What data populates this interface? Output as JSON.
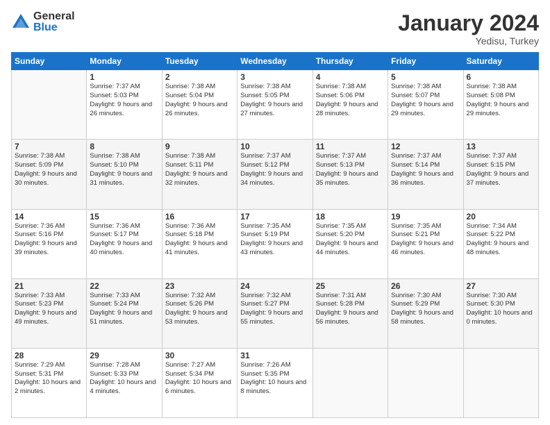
{
  "logo": {
    "general": "General",
    "blue": "Blue"
  },
  "title": "January 2024",
  "location": "Yedisu, Turkey",
  "days": [
    "Sunday",
    "Monday",
    "Tuesday",
    "Wednesday",
    "Thursday",
    "Friday",
    "Saturday"
  ],
  "weeks": [
    [
      {
        "day": null
      },
      {
        "day": 1,
        "sunrise": "7:37 AM",
        "sunset": "5:03 PM",
        "daylight": "9 hours and 26 minutes."
      },
      {
        "day": 2,
        "sunrise": "7:38 AM",
        "sunset": "5:04 PM",
        "daylight": "9 hours and 26 minutes."
      },
      {
        "day": 3,
        "sunrise": "7:38 AM",
        "sunset": "5:05 PM",
        "daylight": "9 hours and 27 minutes."
      },
      {
        "day": 4,
        "sunrise": "7:38 AM",
        "sunset": "5:06 PM",
        "daylight": "9 hours and 28 minutes."
      },
      {
        "day": 5,
        "sunrise": "7:38 AM",
        "sunset": "5:07 PM",
        "daylight": "9 hours and 29 minutes."
      },
      {
        "day": 6,
        "sunrise": "7:38 AM",
        "sunset": "5:08 PM",
        "daylight": "9 hours and 29 minutes."
      }
    ],
    [
      {
        "day": 7,
        "sunrise": "7:38 AM",
        "sunset": "5:09 PM",
        "daylight": "9 hours and 30 minutes."
      },
      {
        "day": 8,
        "sunrise": "7:38 AM",
        "sunset": "5:10 PM",
        "daylight": "9 hours and 31 minutes."
      },
      {
        "day": 9,
        "sunrise": "7:38 AM",
        "sunset": "5:11 PM",
        "daylight": "9 hours and 32 minutes."
      },
      {
        "day": 10,
        "sunrise": "7:37 AM",
        "sunset": "5:12 PM",
        "daylight": "9 hours and 34 minutes."
      },
      {
        "day": 11,
        "sunrise": "7:37 AM",
        "sunset": "5:13 PM",
        "daylight": "9 hours and 35 minutes."
      },
      {
        "day": 12,
        "sunrise": "7:37 AM",
        "sunset": "5:14 PM",
        "daylight": "9 hours and 36 minutes."
      },
      {
        "day": 13,
        "sunrise": "7:37 AM",
        "sunset": "5:15 PM",
        "daylight": "9 hours and 37 minutes."
      }
    ],
    [
      {
        "day": 14,
        "sunrise": "7:36 AM",
        "sunset": "5:16 PM",
        "daylight": "9 hours and 39 minutes."
      },
      {
        "day": 15,
        "sunrise": "7:36 AM",
        "sunset": "5:17 PM",
        "daylight": "9 hours and 40 minutes."
      },
      {
        "day": 16,
        "sunrise": "7:36 AM",
        "sunset": "5:18 PM",
        "daylight": "9 hours and 41 minutes."
      },
      {
        "day": 17,
        "sunrise": "7:35 AM",
        "sunset": "5:19 PM",
        "daylight": "9 hours and 43 minutes."
      },
      {
        "day": 18,
        "sunrise": "7:35 AM",
        "sunset": "5:20 PM",
        "daylight": "9 hours and 44 minutes."
      },
      {
        "day": 19,
        "sunrise": "7:35 AM",
        "sunset": "5:21 PM",
        "daylight": "9 hours and 46 minutes."
      },
      {
        "day": 20,
        "sunrise": "7:34 AM",
        "sunset": "5:22 PM",
        "daylight": "9 hours and 48 minutes."
      }
    ],
    [
      {
        "day": 21,
        "sunrise": "7:33 AM",
        "sunset": "5:23 PM",
        "daylight": "9 hours and 49 minutes."
      },
      {
        "day": 22,
        "sunrise": "7:33 AM",
        "sunset": "5:24 PM",
        "daylight": "9 hours and 51 minutes."
      },
      {
        "day": 23,
        "sunrise": "7:32 AM",
        "sunset": "5:26 PM",
        "daylight": "9 hours and 53 minutes."
      },
      {
        "day": 24,
        "sunrise": "7:32 AM",
        "sunset": "5:27 PM",
        "daylight": "9 hours and 55 minutes."
      },
      {
        "day": 25,
        "sunrise": "7:31 AM",
        "sunset": "5:28 PM",
        "daylight": "9 hours and 56 minutes."
      },
      {
        "day": 26,
        "sunrise": "7:30 AM",
        "sunset": "5:29 PM",
        "daylight": "9 hours and 58 minutes."
      },
      {
        "day": 27,
        "sunrise": "7:30 AM",
        "sunset": "5:30 PM",
        "daylight": "10 hours and 0 minutes."
      }
    ],
    [
      {
        "day": 28,
        "sunrise": "7:29 AM",
        "sunset": "5:31 PM",
        "daylight": "10 hours and 2 minutes."
      },
      {
        "day": 29,
        "sunrise": "7:28 AM",
        "sunset": "5:33 PM",
        "daylight": "10 hours and 4 minutes."
      },
      {
        "day": 30,
        "sunrise": "7:27 AM",
        "sunset": "5:34 PM",
        "daylight": "10 hours and 6 minutes."
      },
      {
        "day": 31,
        "sunrise": "7:26 AM",
        "sunset": "5:35 PM",
        "daylight": "10 hours and 8 minutes."
      },
      {
        "day": null
      },
      {
        "day": null
      },
      {
        "day": null
      }
    ]
  ]
}
